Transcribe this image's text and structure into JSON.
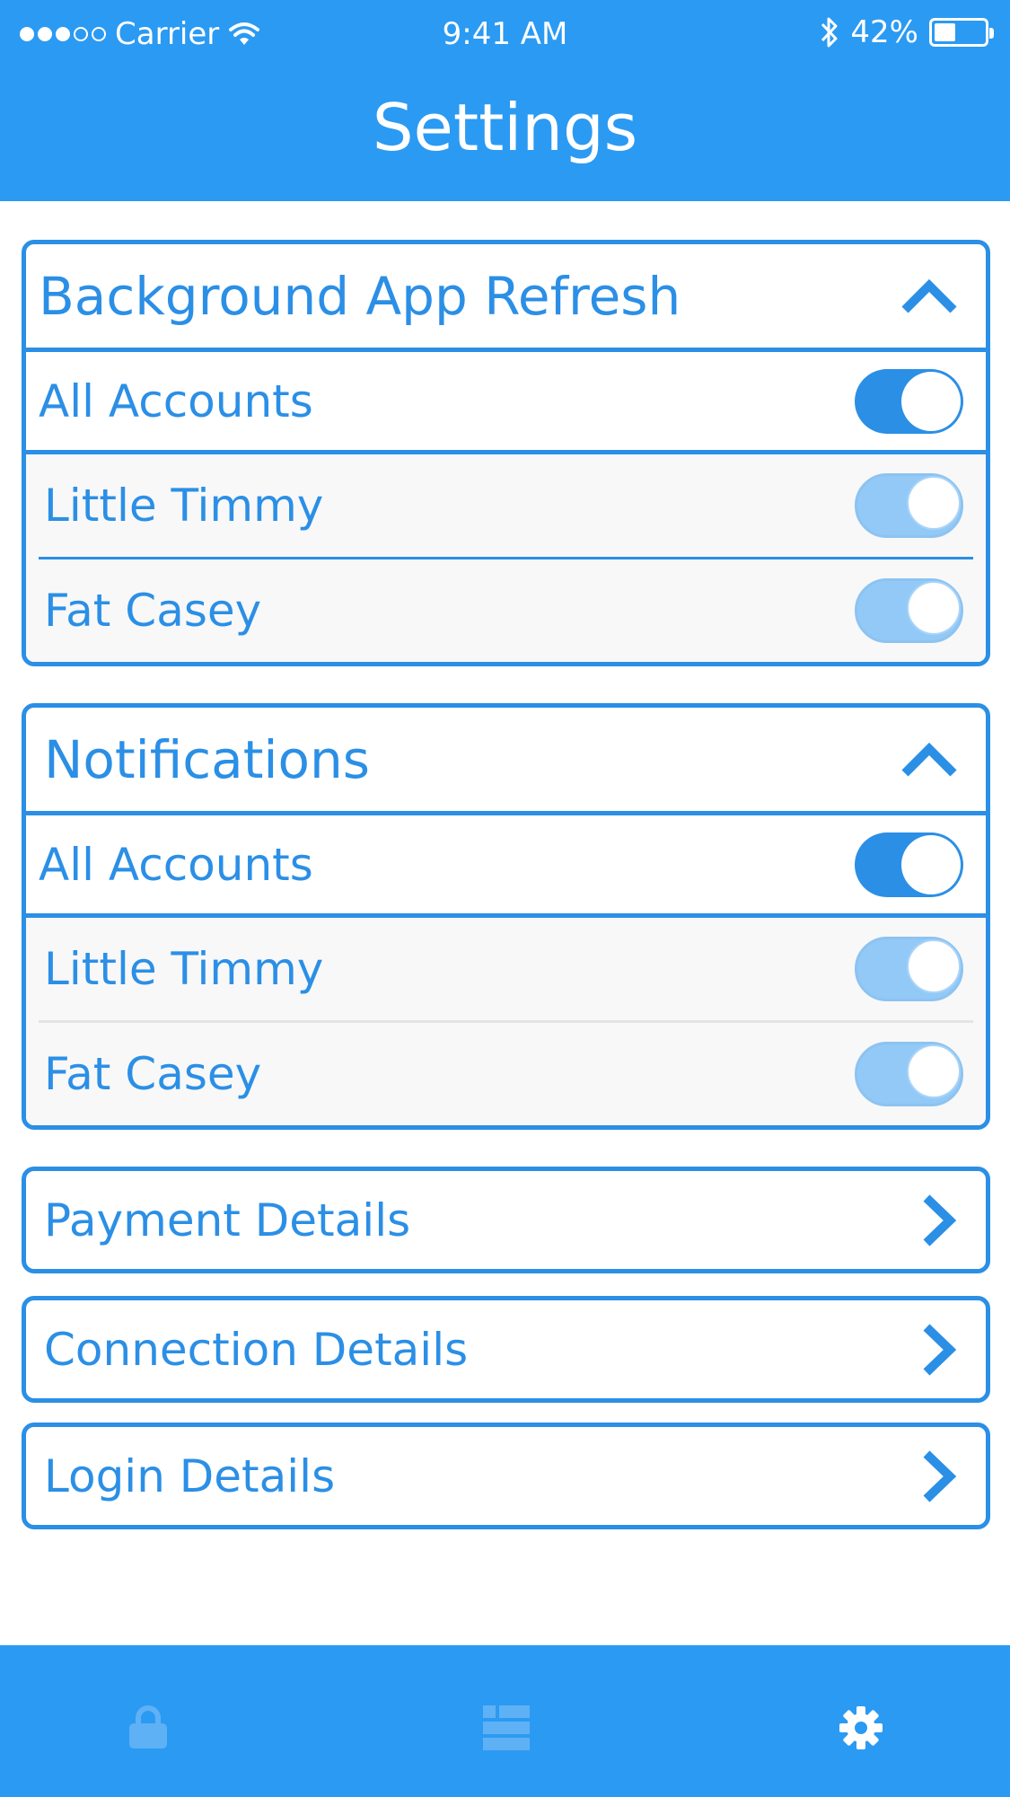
{
  "status_bar": {
    "carrier": "Carrier",
    "time": "9:41 AM",
    "battery_text": "42%",
    "battery_level": 0.42,
    "signal_filled": 3,
    "signal_total": 5
  },
  "header": {
    "title": "Settings"
  },
  "sections": {
    "background_refresh": {
      "title": "Background App Refresh",
      "expanded": true,
      "all": {
        "label": "All Accounts",
        "on": true
      },
      "items": [
        {
          "label": "Little Timmy",
          "on": true
        },
        {
          "label": "Fat Casey",
          "on": true
        }
      ]
    },
    "notifications": {
      "title": "Notifications",
      "expanded": true,
      "all": {
        "label": "All Accounts",
        "on": true
      },
      "items": [
        {
          "label": "Little Timmy",
          "on": true
        },
        {
          "label": "Fat Casey",
          "on": true
        }
      ]
    }
  },
  "links": [
    {
      "label": "Payment Details",
      "icon": "chevron-right-icon"
    },
    {
      "label": "Connection Details",
      "icon": "chevron-right-icon"
    },
    {
      "label": "Login Details",
      "icon": "chevron-right-icon"
    }
  ],
  "tabbar": {
    "tabs": [
      {
        "icon": "lock-icon",
        "active": false
      },
      {
        "icon": "list-icon",
        "active": false
      },
      {
        "icon": "gear-icon",
        "active": true
      }
    ]
  },
  "colors": {
    "accent": "#2b8fe6",
    "header_bg": "#2b9af3",
    "toggle_dim": "#93c9f6",
    "tab_inactive": "#5fb1f5",
    "row_bg": "#f8f8f8"
  }
}
